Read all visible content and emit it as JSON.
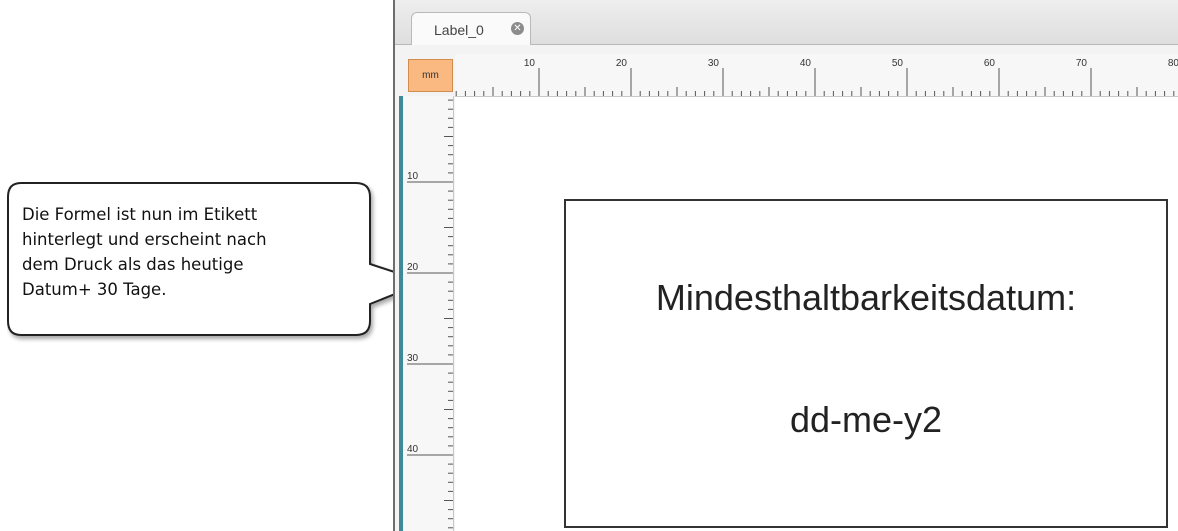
{
  "callout": {
    "text": "Die Formel ist nun im Etikett\nhinterlegt und  erscheint nach\ndem Druck als das heutige\nDatum+ 30 Tage."
  },
  "tabs": [
    {
      "label": "Label_0",
      "close_icon": "close-circle-icon"
    }
  ],
  "ruler": {
    "unit": "mm",
    "horizontal_labels": [
      "10",
      "20",
      "30",
      "40",
      "50",
      "60",
      "70",
      "80"
    ],
    "vertical_labels": [
      "10",
      "20",
      "30",
      "40"
    ]
  },
  "label": {
    "title": "Mindesthaltbarkeitsdatum:",
    "value": "dd-me-y2"
  }
}
